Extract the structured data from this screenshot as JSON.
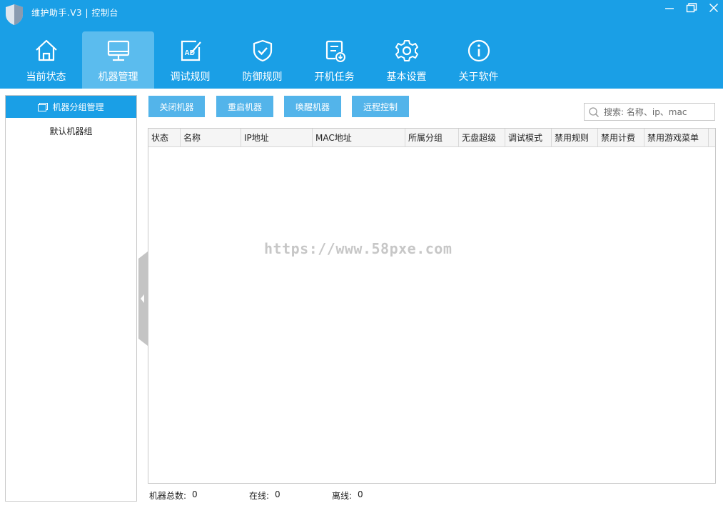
{
  "window": {
    "title": "维护助手.V3 | 控制台",
    "accent": "#1a9fe6",
    "active_tab_color": "#5bbcee"
  },
  "nav": [
    {
      "label": "当前状态",
      "icon": "home-icon"
    },
    {
      "label": "机器管理",
      "icon": "monitor-icon",
      "active": true
    },
    {
      "label": "调试规则",
      "icon": "ad-edit-icon"
    },
    {
      "label": "防御规则",
      "icon": "shield-check-icon"
    },
    {
      "label": "开机任务",
      "icon": "task-download-icon"
    },
    {
      "label": "基本设置",
      "icon": "gear-icon"
    },
    {
      "label": "关于软件",
      "icon": "info-icon"
    }
  ],
  "left_panel": {
    "header": "机器分组管理",
    "groups": [
      "默认机器组"
    ]
  },
  "toolbar": {
    "shutdown": "关闭机器",
    "restart": "重启机器",
    "wake": "唤醒机器",
    "remote": "远程控制"
  },
  "search": {
    "placeholder": "搜索: 名称、ip、mac"
  },
  "table": {
    "columns": [
      "状态",
      "名称",
      "IP地址",
      "MAC地址",
      "所属分组",
      "无盘超级",
      "调试模式",
      "禁用规则",
      "禁用计费",
      "禁用游戏菜单"
    ],
    "rows": []
  },
  "watermark": "https://www.58pxe.com",
  "status": {
    "total_label": "机器总数:",
    "total": "0",
    "online_label": "在线:",
    "online": "0",
    "offline_label": "离线:",
    "offline": "0"
  }
}
